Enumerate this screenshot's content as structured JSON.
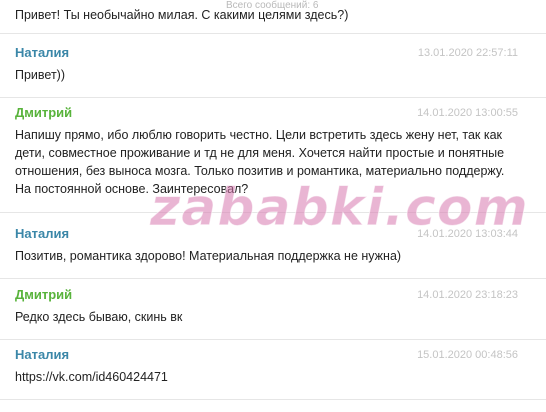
{
  "header": {
    "total_messages": "Всего сообщений: 6"
  },
  "top_fragment": {
    "text": "Привет! Ты необычайно милая. С какими целями здесь?)"
  },
  "messages": [
    {
      "author": "Наталия",
      "time": "13.01.2020 22:57:11",
      "text": "Привет))"
    },
    {
      "author": "Дмитрий",
      "time": "14.01.2020 13:00:55",
      "text": "Напишу прямо, ибо люблю говорить честно. Цели встретить здесь жену нет, так как дети, совместное проживание и тд не для меня. Хочется найти простые и понятные отношения, без выноса мозга. Только позитив и романтика, материально поддержу. На постоянной основе. Заинтересовал?"
    },
    {
      "author": "Наталия",
      "time": "14.01.2020 13:03:44",
      "text": "Позитив, романтика здорово! Материальная поддержка не нужна)"
    },
    {
      "author": "Дмитрий",
      "time": "14.01.2020 23:18:23",
      "text": "Редко здесь бываю, скинь вк"
    },
    {
      "author": "Наталия",
      "time": "15.01.2020 00:48:56",
      "text": "https://vk.com/id460424471"
    }
  ],
  "watermark": "zababki.com",
  "colors": {
    "female_author": "#3b87a8",
    "male_author": "#58b33b",
    "timestamp": "#c4c4c4",
    "body_text": "#222222",
    "watermark": "#d778af"
  }
}
